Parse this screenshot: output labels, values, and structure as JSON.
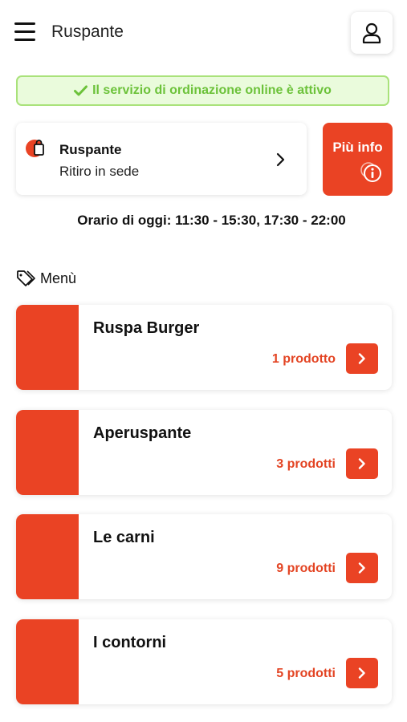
{
  "header": {
    "title": "Ruspante"
  },
  "status": {
    "message": "Il servizio di ordinazione online è attivo"
  },
  "store": {
    "name": "Ruspante",
    "mode": "Ritiro in sede",
    "info_label": "Più info"
  },
  "hours": "Orario di oggi: 11:30 - 15:30, 17:30 - 22:00",
  "menu": {
    "section_label": "Menù",
    "categories": [
      {
        "title": "Ruspa Burger",
        "count": "1 prodotto"
      },
      {
        "title": "Aperuspante",
        "count": "3 prodotti"
      },
      {
        "title": "Le carni",
        "count": "9 prodotti"
      },
      {
        "title": "I contorni",
        "count": "5 prodotti"
      }
    ]
  },
  "colors": {
    "accent": "#ea4324",
    "success_text": "#6cc23a",
    "success_bg": "#eafbdc",
    "success_border": "#a9e27a"
  },
  "icons": {
    "menu": "hamburger-icon",
    "user": "user-icon",
    "check": "check-icon",
    "bag": "shopping-bag-icon",
    "chevron": "chevron-right-icon",
    "info": "info-icon",
    "tag": "tag-icon"
  }
}
